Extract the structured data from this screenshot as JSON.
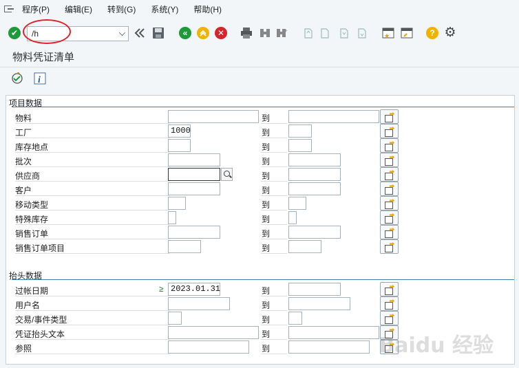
{
  "menubar": {
    "items": [
      "程序(P)",
      "编辑(E)",
      "转到(G)",
      "系统(Y)",
      "帮助(H)"
    ]
  },
  "toolbar": {
    "command_value": "/h",
    "icons": [
      "enter-check-icon",
      "dropdown-icon",
      "back-double-icon",
      "save-icon",
      "back-icon",
      "exit-icon",
      "cancel-icon",
      "print-icon",
      "find-icon",
      "find-next-icon",
      "first-page-icon",
      "previous-page-icon",
      "next-page-icon",
      "last-page-icon",
      "create-session-icon",
      "shortcut-icon",
      "help-icon",
      "settings-icon"
    ]
  },
  "title": "物料凭证清单",
  "app_toolbar": {
    "icons": [
      "execute-icon",
      "info-icon"
    ]
  },
  "sections": {
    "item_data": {
      "title": "项目数据",
      "to_label": "到",
      "rows": [
        {
          "label": "物料",
          "value": "",
          "op": "",
          "to_value": ""
        },
        {
          "label": "工厂",
          "value": "1000",
          "op": "",
          "to_value": ""
        },
        {
          "label": "库存地点",
          "value": "",
          "op": "",
          "to_value": ""
        },
        {
          "label": "批次",
          "value": "",
          "op": "",
          "to_value": ""
        },
        {
          "label": "供应商",
          "value": "",
          "op": "",
          "to_value": ""
        },
        {
          "label": "客户",
          "value": "",
          "op": "",
          "to_value": ""
        },
        {
          "label": "移动类型",
          "value": "",
          "op": "",
          "to_value": ""
        },
        {
          "label": "特殊库存",
          "value": "",
          "op": "",
          "to_value": ""
        },
        {
          "label": "销售订单",
          "value": "",
          "op": "",
          "to_value": ""
        },
        {
          "label": "销售订单项目",
          "value": "",
          "op": "",
          "to_value": ""
        }
      ]
    },
    "header_data": {
      "title": "抬头数据",
      "to_label": "到",
      "rows": [
        {
          "label": "过帐日期",
          "value": "2023.01.31",
          "op": "≥",
          "to_value": ""
        },
        {
          "label": "用户名",
          "value": "",
          "op": "",
          "to_value": ""
        },
        {
          "label": "交易/事件类型",
          "value": "",
          "op": "",
          "to_value": ""
        },
        {
          "label": "凭证抬头文本",
          "value": "",
          "op": "",
          "to_value": ""
        },
        {
          "label": "参照",
          "value": "",
          "op": "",
          "to_value": ""
        }
      ]
    }
  },
  "watermark": "Baidu 经验",
  "colors": {
    "green": "#1f9a3a",
    "orange": "#e8a200",
    "red": "#d7242b",
    "gold": "#f0b400",
    "annotation_red": "#e0202a"
  }
}
